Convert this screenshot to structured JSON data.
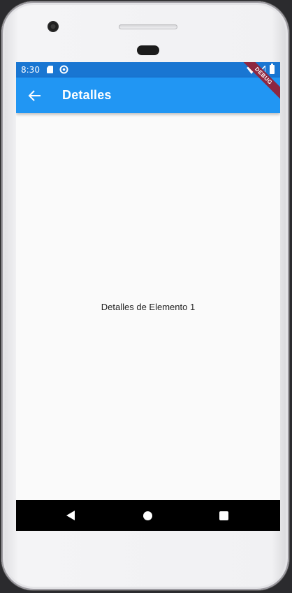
{
  "status_bar": {
    "time": "8:30",
    "icons": [
      "sd-card-icon",
      "sync-icon",
      "wifi-icon",
      "signal-icon",
      "battery-icon"
    ]
  },
  "app_bar": {
    "title": "Detalles",
    "back_icon": "arrow-back-icon",
    "color": "#2196f3"
  },
  "debug_banner": {
    "label": "DEBUG"
  },
  "content": {
    "text": "Detalles de Elemento 1"
  },
  "navigation_bar": {
    "buttons": [
      "back-triangle-icon",
      "home-circle-icon",
      "recents-square-icon"
    ]
  },
  "colors": {
    "status_bar": "#1976d2",
    "app_bar": "#2196f3",
    "background": "#fafafa",
    "debug_banner": "#8e2740"
  }
}
